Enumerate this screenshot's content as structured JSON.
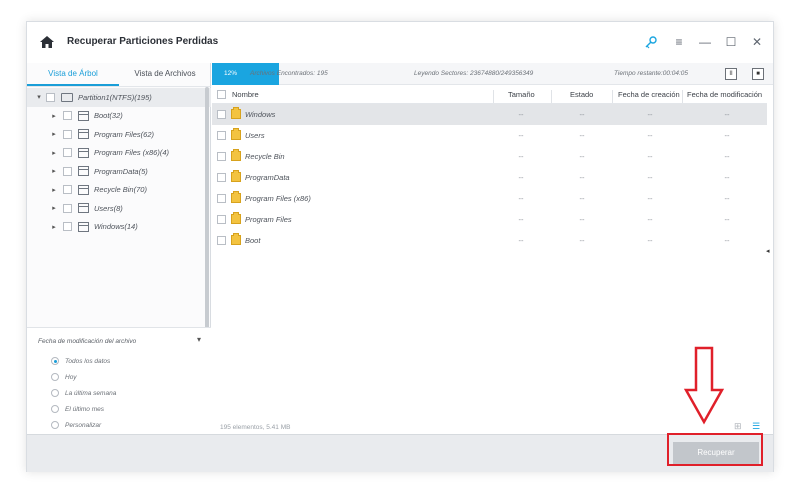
{
  "window": {
    "title": "Recuperar Particiones Perdidas"
  },
  "tabs": [
    {
      "label": "Vista de Árbol",
      "active": true
    },
    {
      "label": "Vista de Archivos",
      "active": false
    }
  ],
  "tree": {
    "root": "Partition1(NTFS)(195)",
    "items": [
      {
        "label": "Boot(32)"
      },
      {
        "label": "Program Files(62)"
      },
      {
        "label": "Program Files (x86)(4)"
      },
      {
        "label": "ProgramData(5)"
      },
      {
        "label": "Recycle Bin(70)"
      },
      {
        "label": "Users(8)"
      },
      {
        "label": "Windows(14)"
      }
    ]
  },
  "filter": {
    "heading": "Fecha de modificación del archivo",
    "options": [
      {
        "label": "Todos los datos",
        "selected": true
      },
      {
        "label": "Hoy",
        "selected": false
      },
      {
        "label": "La última semana",
        "selected": false
      },
      {
        "label": "El último mes",
        "selected": false
      },
      {
        "label": "Personalizar",
        "selected": false
      }
    ]
  },
  "infobar": {
    "progress_pct": "12%",
    "found": "Archivos Encontrados: 195",
    "reading": "Leyendo Sectores: 23674880/249356349",
    "time": "Tiempo restante:00:04:05",
    "pause_label": "II",
    "stop_label": "■"
  },
  "list": {
    "columns": [
      "Nombre",
      "Tamaño",
      "Estado",
      "Fecha de creación",
      "Fecha de modificación"
    ],
    "rows": [
      {
        "name": "Windows",
        "size": "--",
        "status": "--",
        "created": "--",
        "modified": "--",
        "selected": true
      },
      {
        "name": "Users",
        "size": "--",
        "status": "--",
        "created": "--",
        "modified": "--",
        "selected": false
      },
      {
        "name": "Recycle Bin",
        "size": "--",
        "status": "--",
        "created": "--",
        "modified": "--",
        "selected": false
      },
      {
        "name": "ProgramData",
        "size": "--",
        "status": "--",
        "created": "--",
        "modified": "--",
        "selected": false
      },
      {
        "name": "Program Files (x86)",
        "size": "--",
        "status": "--",
        "created": "--",
        "modified": "--",
        "selected": false
      },
      {
        "name": "Program Files",
        "size": "--",
        "status": "--",
        "created": "--",
        "modified": "--",
        "selected": false
      },
      {
        "name": "Boot",
        "size": "--",
        "status": "--",
        "created": "--",
        "modified": "--",
        "selected": false
      }
    ],
    "footer": "195 elementos, 5.41 MB"
  },
  "bottom": {
    "recover_label": "Recuperar"
  },
  "colors": {
    "accent": "#1aa5e0",
    "annotation": "#e0202a",
    "folder": "#f3c340"
  }
}
